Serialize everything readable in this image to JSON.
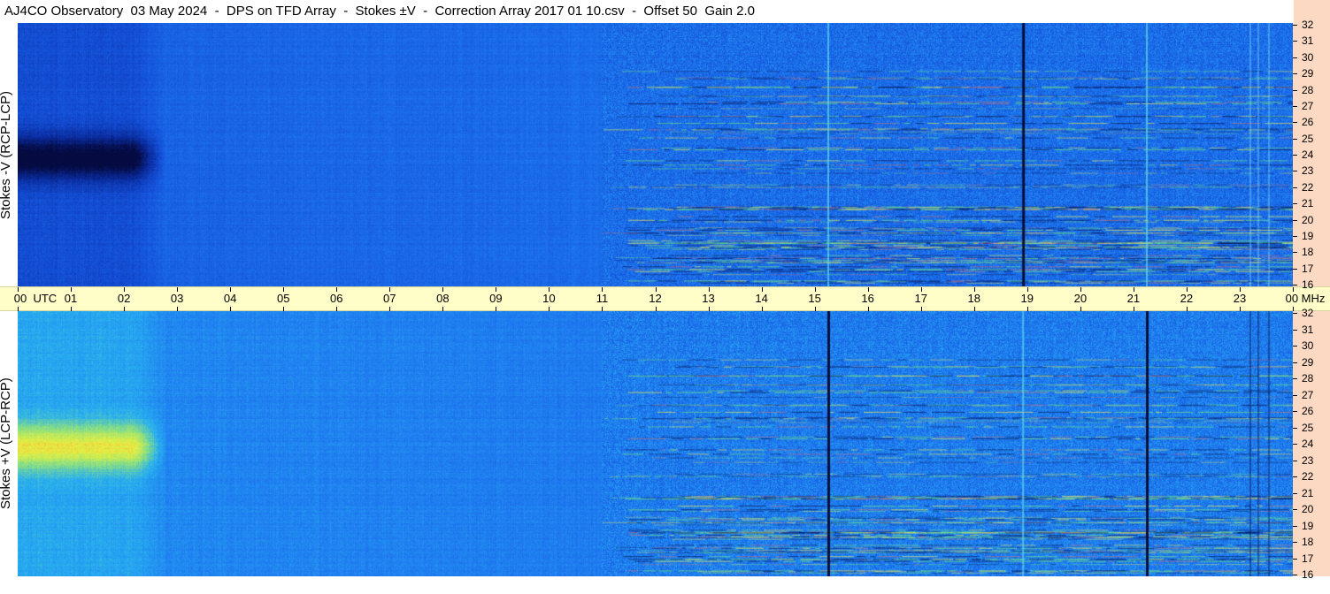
{
  "header": {
    "title": "AJ4CO Observatory  03 May 2024  -  DPS on TFD Array  -  Stokes ±V  -  Correction Array 2017 01 10.csv  -  Offset 50  Gain 2.0"
  },
  "chart_data": {
    "type": "heatmap",
    "title": "AJ4CO Observatory  03 May 2024  -  DPS on TFD Array  -  Stokes ±V  -  Correction Array 2017 01 10.csv  -  Offset 50  Gain 2.0",
    "x": {
      "unit": "UTC",
      "range": [
        0,
        24
      ],
      "tick_labels": [
        "00",
        "01",
        "02",
        "03",
        "04",
        "05",
        "06",
        "07",
        "08",
        "09",
        "10",
        "11",
        "12",
        "13",
        "14",
        "15",
        "16",
        "17",
        "18",
        "19",
        "20",
        "21",
        "22",
        "23",
        "00"
      ],
      "first_label_suffix": "UTC",
      "last_label_suffix": "MHz"
    },
    "y": {
      "unit": "MHz",
      "range": [
        16,
        32
      ],
      "tick_labels": [
        "32",
        "31",
        "30",
        "29",
        "28",
        "27",
        "26",
        "25",
        "24",
        "23",
        "22",
        "21",
        "20",
        "19",
        "18",
        "17",
        "16"
      ]
    },
    "panels": [
      {
        "ylabel": "Stokes -V (RCP-LCP)",
        "sign": -1
      },
      {
        "ylabel": "Stokes +V (LCP-RCP)",
        "sign": 1
      }
    ],
    "colormap": [
      "#050a40",
      "#0a2a9a",
      "#1450d8",
      "#1e78f0",
      "#28b0f0",
      "#8ce080",
      "#e8f040",
      "#ff8040",
      "#ff3030"
    ],
    "features": {
      "dark_vertical_lines_top_utc": [
        18.92
      ],
      "cyan_vertical_lines_top_utc": [
        15.25,
        21.25
      ],
      "dark_vertical_lines_bottom_utc": [
        15.25,
        21.25
      ],
      "cyan_vertical_lines_bottom_utc": [
        18.92
      ],
      "intense_region": {
        "utc": [
          0,
          2.2
        ],
        "mhz": [
          22.8,
          24.8
        ]
      },
      "background_change_utc": 11
    }
  }
}
